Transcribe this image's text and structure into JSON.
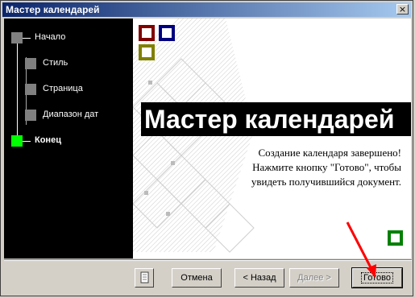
{
  "window": {
    "title": "Мастер календарей",
    "close_glyph": "×"
  },
  "sidebar": {
    "steps": [
      {
        "label": "Начало",
        "state": "done"
      },
      {
        "label": "Стиль",
        "state": "done"
      },
      {
        "label": "Страница",
        "state": "done"
      },
      {
        "label": "Диапазон дат",
        "state": "done"
      },
      {
        "label": "Конец",
        "state": "current"
      }
    ]
  },
  "content": {
    "heading": "Мастер календарей",
    "description_lines": [
      "Создание календаря завершено!",
      "Нажмите кнопку \"Готово\", чтобы",
      "увидеть получившийся документ."
    ]
  },
  "buttons": {
    "help_icon": "help-icon",
    "cancel": "Отмена",
    "back": "< Назад",
    "next": "Далее >",
    "finish": "Готово"
  },
  "colors": {
    "title_bar_start": "#0a246a",
    "title_bar_end": "#a6caf0",
    "current_step": "#00ff00",
    "done_step": "#808080",
    "sidebar_bg": "#000000",
    "annotation_arrow": "#ff0000",
    "square_red": "#800000",
    "square_blue": "#000080",
    "square_olive": "#808000",
    "square_green": "#008000"
  }
}
